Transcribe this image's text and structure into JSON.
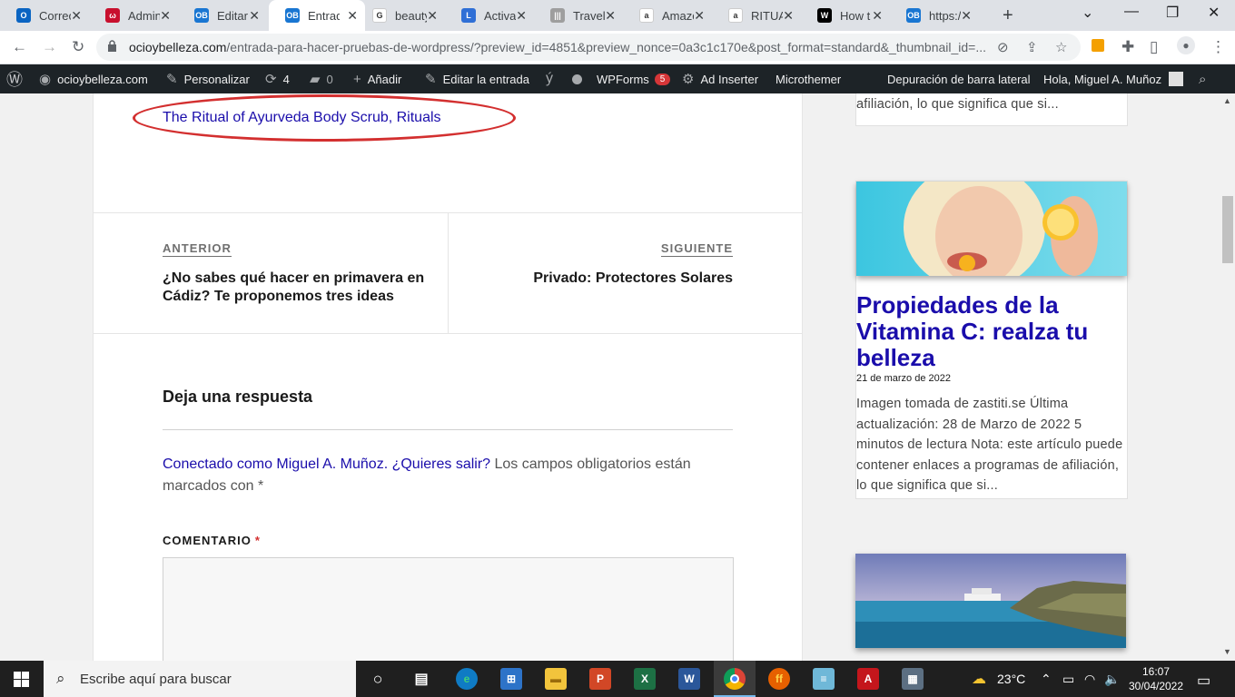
{
  "tabs": [
    {
      "title": "Correo",
      "fav_color": "#0a64c2",
      "fav_text": "O"
    },
    {
      "title": "Admin",
      "fav_color": "#c8102e",
      "fav_text": "ω"
    },
    {
      "title": "Editar",
      "fav_color": "#1976d2",
      "fav_text": "OB"
    },
    {
      "title": "Entrada",
      "fav_color": "#1976d2",
      "fav_text": "OB"
    },
    {
      "title": "beauty",
      "fav_color": "#ffffff",
      "fav_text": "G"
    },
    {
      "title": "Activa",
      "fav_color": "#2f6fd6",
      "fav_text": "L"
    },
    {
      "title": "Travel",
      "fav_color": "#9e9e9e",
      "fav_text": "|||"
    },
    {
      "title": "Amazo",
      "fav_color": "#ffffff",
      "fav_text": "a"
    },
    {
      "title": "RITUA",
      "fav_color": "#ffffff",
      "fav_text": "a"
    },
    {
      "title": "How t",
      "fav_color": "#000000",
      "fav_text": "W"
    },
    {
      "title": "https:/",
      "fav_color": "#1976d2",
      "fav_text": "OB"
    }
  ],
  "address": {
    "domain": "ocioybelleza.com",
    "path": "/entrada-para-hacer-pruebas-de-wordpress/?preview_id=4851&preview_nonce=0a3c1c170e&post_format=standard&_thumbnail_id=..."
  },
  "adminbar": {
    "site": "ocioybelleza.com",
    "customize": "Personalizar",
    "updates": "4",
    "comments": "0",
    "new": "Añadir",
    "edit": "Editar la entrada",
    "wpforms": "WPForms",
    "wpforms_badge": "5",
    "ad_inserter": "Ad Inserter",
    "microthemer": "Microthemer",
    "debug": "Depuración de barra lateral",
    "greeting": "Hola, Miguel A. Muñoz"
  },
  "content": {
    "top_link": "The Ritual of Ayurveda Body Scrub, Rituals",
    "prev_label": "ANTERIOR",
    "prev_title": "¿No sabes qué hacer en primavera en Cádiz? Te proponemos tres ideas",
    "next_label": "SIGUIENTE",
    "next_title": "Privado: Protectores Solares",
    "reply_title": "Deja una respuesta",
    "logged_prefix": "Conectado como ",
    "logged_user": "Miguel A. Muñoz",
    "logged_dot": ". ",
    "logout_link": "¿Quieres salir?",
    "logged_suffix": " Los campos obligatorios están marcados con *",
    "comment_label": "COMENTARIO",
    "comment_req": "*"
  },
  "sidebar": {
    "card1_text": "puede contener enlaces a programas de afiliación, lo que significa que si...",
    "card2_title": "Propiedades de la Vitamina C: realza tu belleza",
    "card2_date": "21 de marzo de 2022",
    "card2_text": "Imagen tomada de zastiti.se Última actualización: 28 de Marzo de 2022 5 minutos de lectura Nota: este artículo puede contener enlaces a programas de afiliación, lo que significa que si..."
  },
  "taskbar": {
    "search_placeholder": "Escribe aquí para buscar",
    "temperature": "23°C",
    "time": "16:07",
    "date": "30/04/2022"
  }
}
